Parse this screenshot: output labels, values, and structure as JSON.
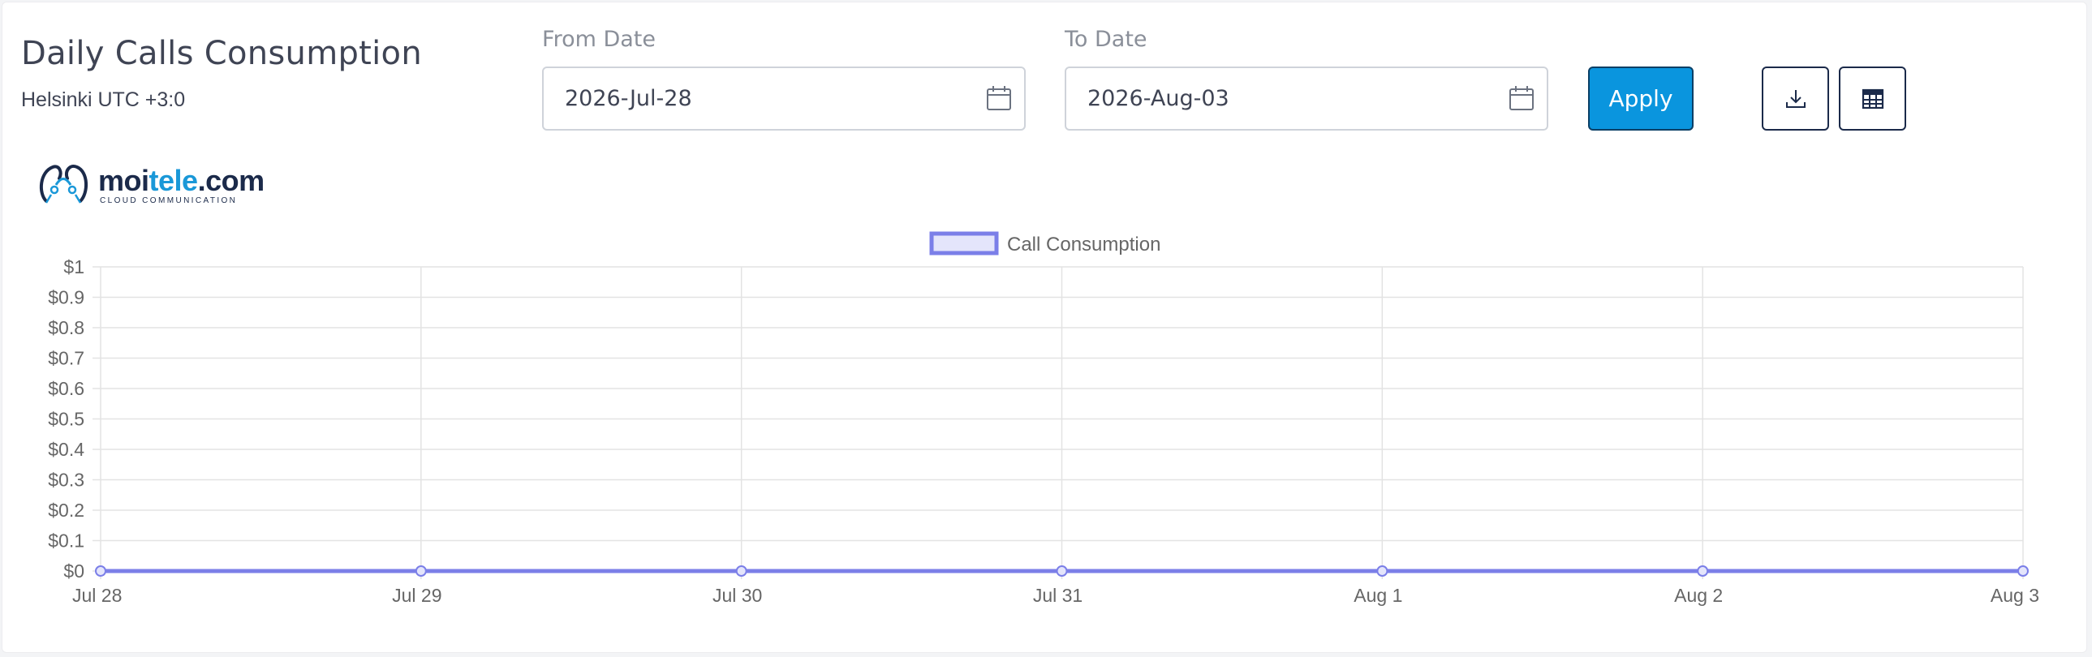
{
  "header": {
    "title": "Daily Calls Consumption",
    "timezone": "Helsinki UTC +3:0"
  },
  "filters": {
    "from_label": "From Date",
    "from_value": "2026-Jul-28",
    "to_label": "To Date",
    "to_value": "2026-Aug-03",
    "apply_label": "Apply"
  },
  "toolbar": {
    "download_icon": "download-icon",
    "table_icon": "table-icon"
  },
  "logo": {
    "name_main": "moi",
    "name_accent": "tele",
    "name_suffix": ".com",
    "tagline": "CLOUD COMMUNICATION"
  },
  "colors": {
    "accent": "#0a95de",
    "series": "#7b7fe8",
    "logo_dark": "#1b2a4a",
    "logo_blue": "#1a98d8"
  },
  "chart_data": {
    "type": "line",
    "categories": [
      "Jul 28",
      "Jul 29",
      "Jul 30",
      "Jul 31",
      "Aug 1",
      "Aug 2",
      "Aug 3"
    ],
    "series": [
      {
        "name": "Call Consumption",
        "values": [
          0,
          0,
          0,
          0,
          0,
          0,
          0
        ]
      }
    ],
    "y_ticks": [
      "$0",
      "$0.1",
      "$0.2",
      "$0.3",
      "$0.4",
      "$0.5",
      "$0.6",
      "$0.7",
      "$0.8",
      "$0.9",
      "$1"
    ],
    "ylim": [
      0,
      1
    ],
    "grid": true,
    "legend": "top"
  }
}
